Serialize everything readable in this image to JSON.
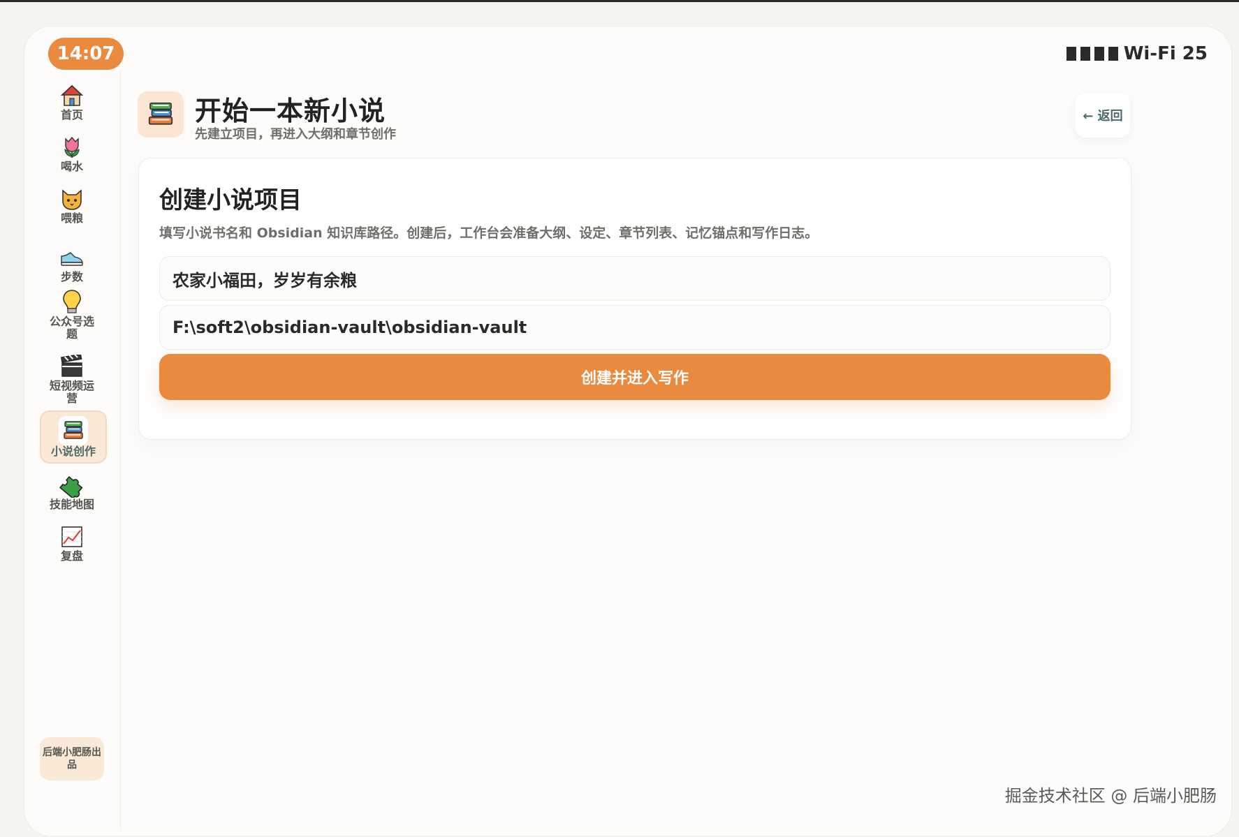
{
  "status_bar": {
    "time": "14:07",
    "network": "Wi-Fi 25",
    "signal_bars": 4
  },
  "sidebar": {
    "items": [
      {
        "label": "首页",
        "icon": "house-icon",
        "active": false
      },
      {
        "label": "喝水",
        "icon": "tulip-icon",
        "active": false
      },
      {
        "label": "喂粮",
        "icon": "cat-face-icon",
        "active": false
      },
      {
        "label": "步数",
        "icon": "sneaker-icon",
        "active": false
      },
      {
        "label": "公众号选题",
        "icon": "lightbulb-icon",
        "active": false
      },
      {
        "label": "短视频运营",
        "icon": "clapperboard-icon",
        "active": false
      },
      {
        "label": "小说创作",
        "icon": "books-icon",
        "active": true
      },
      {
        "label": "技能地图",
        "icon": "puzzle-icon",
        "active": false
      },
      {
        "label": "复盘",
        "icon": "chart-up-icon",
        "active": false
      }
    ],
    "credit": "后端小肥肠出品"
  },
  "header": {
    "icon": "books-icon",
    "title": "开始一本新小说",
    "subtitle": "先建立项目，再进入大纲和章节创作",
    "back_label": "← 返回"
  },
  "form": {
    "title": "创建小说项目",
    "description": "填写小说书名和 Obsidian 知识库路径。创建后，工作台会准备大纲、设定、章节列表、记忆锚点和写作日志。",
    "book_name_value": "农家小福田，岁岁有余粮",
    "vault_path_value": "F:\\soft2\\obsidian-vault\\obsidian-vault",
    "submit_label": "创建并进入写作"
  },
  "watermark": "掘金技术社区 @ 后端小肥肠",
  "colors": {
    "accent": "#ea8a3e",
    "accent_soft": "#fbe9d8",
    "background": "#fdfcfa",
    "text_primary": "#222220",
    "text_secondary": "#6f6f6a"
  }
}
